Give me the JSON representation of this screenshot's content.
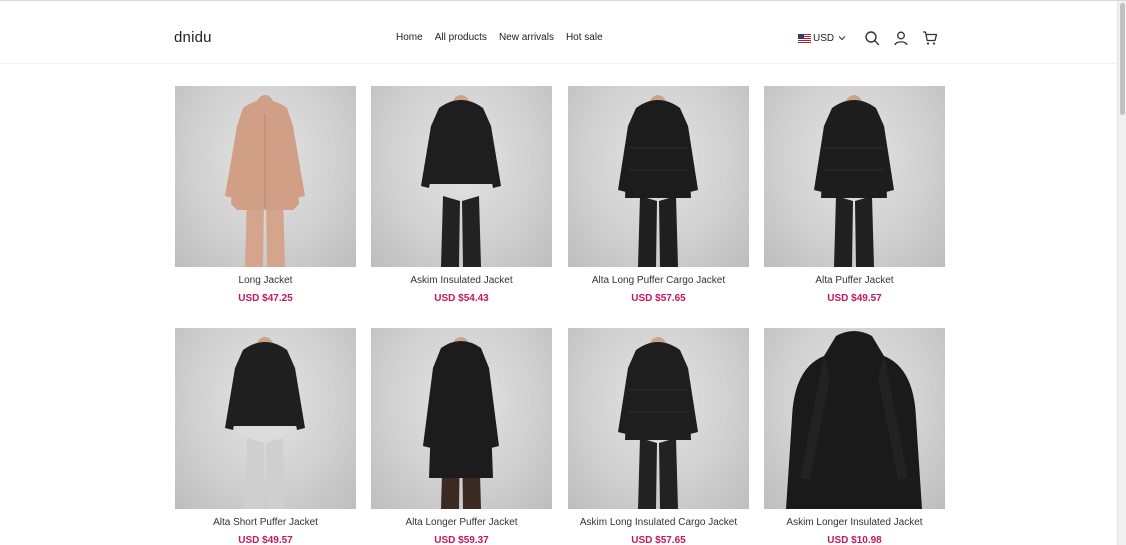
{
  "header": {
    "logo": "dnidu",
    "nav": [
      "Home",
      "All products",
      "New arrivals",
      "Hot sale"
    ],
    "currency": "USD"
  },
  "icons": {
    "flag": "us-flag-icon",
    "currency_chevron": "chevron-down-icon",
    "search": "search-icon",
    "account": "user-icon",
    "cart": "cart-icon"
  },
  "colors": {
    "price": "#c2185b",
    "text": "#333333"
  },
  "products": [
    {
      "name": "Long Jacket",
      "price": "USD $47.25",
      "jacket_color": "#d19f86",
      "pants_color": "#d4a58c",
      "style": "rain"
    },
    {
      "name": "Askim Insulated Jacket",
      "price": "USD $54.43",
      "jacket_color": "#1e1e1e",
      "pants_color": "#222222",
      "style": "short"
    },
    {
      "name": "Alta Long Puffer Cargo Jacket",
      "price": "USD $57.65",
      "jacket_color": "#1c1c1c",
      "pants_color": "#1f1f1f",
      "style": "puffer"
    },
    {
      "name": "Alta Puffer Jacket",
      "price": "USD $49.57",
      "jacket_color": "#1d1d1d",
      "pants_color": "#202020",
      "style": "puffer"
    },
    {
      "name": "Alta Short Puffer Jacket",
      "price": "USD $49.57",
      "jacket_color": "#1f1f1f",
      "pants_color": "#cfcfcf",
      "style": "short"
    },
    {
      "name": "Alta Longer Puffer Jacket",
      "price": "USD $59.37",
      "jacket_color": "#1c1c1c",
      "pants_color": "#3a2a22",
      "style": "long"
    },
    {
      "name": "Askim Long Insulated Cargo Jacket",
      "price": "USD $57.65",
      "jacket_color": "#1e1e1e",
      "pants_color": "#222222",
      "style": "puffer"
    },
    {
      "name": "Askim Longer Insulated Jacket",
      "price": "USD $10.98",
      "jacket_color": "#1a1a1a",
      "pants_color": "#1a1a1a",
      "style": "flat"
    }
  ]
}
